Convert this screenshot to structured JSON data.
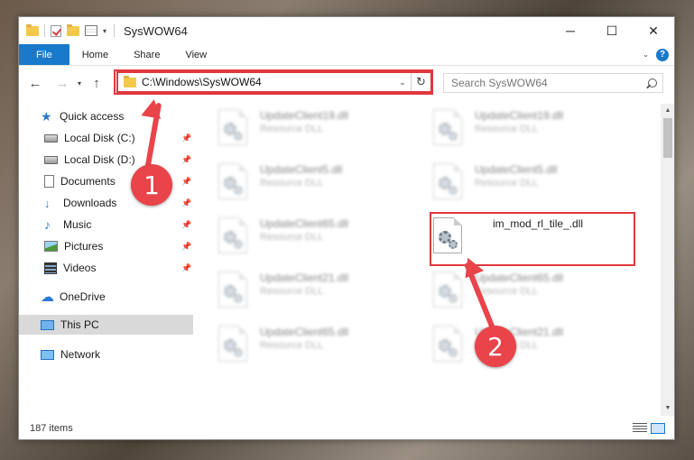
{
  "window": {
    "title": "SysWOW64",
    "controls": {
      "minimize": "─",
      "maximize": "☐",
      "close": "✕"
    }
  },
  "ribbon": {
    "tabs": [
      "File",
      "Home",
      "Share",
      "View"
    ],
    "help": "?"
  },
  "nav": {
    "back": "←",
    "forward": "→",
    "recent": "▾",
    "up": "↑",
    "address": "C:\\Windows\\SysWOW64",
    "refresh": "↻",
    "search_placeholder": "Search SysWOW64"
  },
  "sidebar": {
    "items": [
      {
        "label": "Quick access",
        "icon": "star-icon",
        "pinned": false
      },
      {
        "label": "Local Disk (C:)",
        "icon": "disk-icon",
        "pinned": true
      },
      {
        "label": "Local Disk (D:)",
        "icon": "disk-icon",
        "pinned": true
      },
      {
        "label": "Documents",
        "icon": "documents-icon",
        "pinned": true
      },
      {
        "label": "Downloads",
        "icon": "downloads-icon",
        "pinned": true
      },
      {
        "label": "Music",
        "icon": "music-icon",
        "pinned": true
      },
      {
        "label": "Pictures",
        "icon": "pictures-icon",
        "pinned": true
      },
      {
        "label": "Videos",
        "icon": "videos-icon",
        "pinned": true
      },
      {
        "label": "OneDrive",
        "icon": "onedrive-icon",
        "pinned": false
      },
      {
        "label": "This PC",
        "icon": "this-pc-icon",
        "pinned": false,
        "selected": true
      },
      {
        "label": "Network",
        "icon": "network-icon",
        "pinned": false
      }
    ],
    "pin_glyph": "📌"
  },
  "files": [
    {
      "name": "UpdateClient19.dll",
      "type": "Resource DLL",
      "blurred": true
    },
    {
      "name": "UpdateClient19.dll",
      "type": "Resource DLL",
      "blurred": true
    },
    {
      "name": "UpdateClient5.dll",
      "type": "Resource DLL",
      "blurred": true
    },
    {
      "name": "UpdateClient5.dll",
      "type": "Resource DLL",
      "blurred": true
    },
    {
      "name": "UpdateClient65.dll",
      "type": "Resource DLL",
      "blurred": true
    },
    {
      "name": "im_mod_rl_tile_.dll",
      "type": "",
      "blurred": false
    },
    {
      "name": "UpdateClient21.dll",
      "type": "Resource DLL",
      "blurred": true
    },
    {
      "name": "UpdateClient65.dll",
      "type": "Resource DLL",
      "blurred": true
    },
    {
      "name": "UpdateClient65.dll",
      "type": "Resource DLL",
      "blurred": true
    },
    {
      "name": "UpdateClient21.dll",
      "type": "Resource DLL",
      "blurred": true
    }
  ],
  "status": {
    "items": "187 items"
  },
  "annotations": {
    "badge1": "1",
    "badge2": "2",
    "color": "#e8444a"
  }
}
